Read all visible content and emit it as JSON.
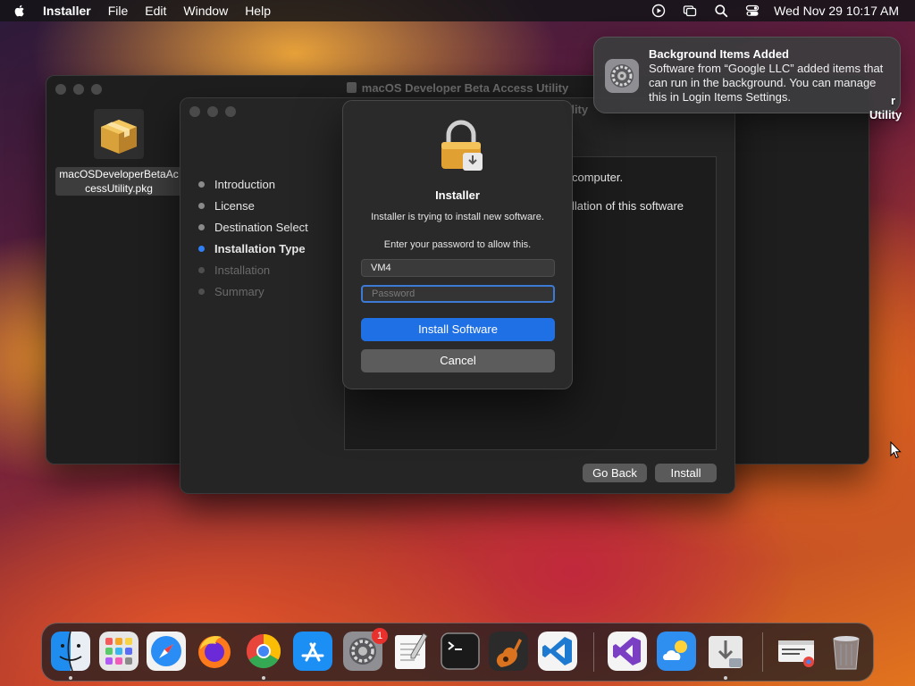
{
  "menubar": {
    "app_name": "Installer",
    "menus": [
      "File",
      "Edit",
      "Window",
      "Help"
    ],
    "clock": "Wed Nov 29  10:17 AM"
  },
  "back_window": {
    "title": "macOS Developer Beta Access Utility"
  },
  "desktop_file": {
    "label": "macOSDeveloperBetaAccessUtility.pkg"
  },
  "installer": {
    "title_fragment": "Utility",
    "steps": [
      {
        "label": "Introduction",
        "state": "done"
      },
      {
        "label": "License",
        "state": "done"
      },
      {
        "label": "Destination Select",
        "state": "done"
      },
      {
        "label": "Installation Type",
        "state": "current"
      },
      {
        "label": "Installation",
        "state": "pending"
      },
      {
        "label": "Summary",
        "state": "pending"
      }
    ],
    "content_line1": "computer.",
    "content_line2": "llation of this software",
    "go_back_label": "Go Back",
    "install_label": "Install"
  },
  "dialog": {
    "title": "Installer",
    "message": "Installer is trying to install new software.",
    "prompt": "Enter your password to allow this.",
    "username": "VM4",
    "password_placeholder": "Password",
    "install_button": "Install Software",
    "cancel_button": "Cancel"
  },
  "notification": {
    "title": "Background Items Added",
    "body": "Software from “Google LLC” added items that can run in the background. You can manage this in Login Items Settings."
  },
  "right_edge_text": {
    "line1": "r",
    "line2": "Utility"
  },
  "dock": {
    "settings_badge": "1",
    "apps": [
      "finder-icon",
      "launchpad-icon",
      "safari-icon",
      "firefox-icon",
      "chrome-icon",
      "app-store-icon",
      "system-settings-icon",
      "textedit-icon",
      "terminal-icon",
      "garageband-icon",
      "vscode-icon",
      "visual-studio-icon",
      "weather-icon",
      "installer-download-icon",
      "chrome-app-window-icon",
      "trash-icon"
    ]
  }
}
